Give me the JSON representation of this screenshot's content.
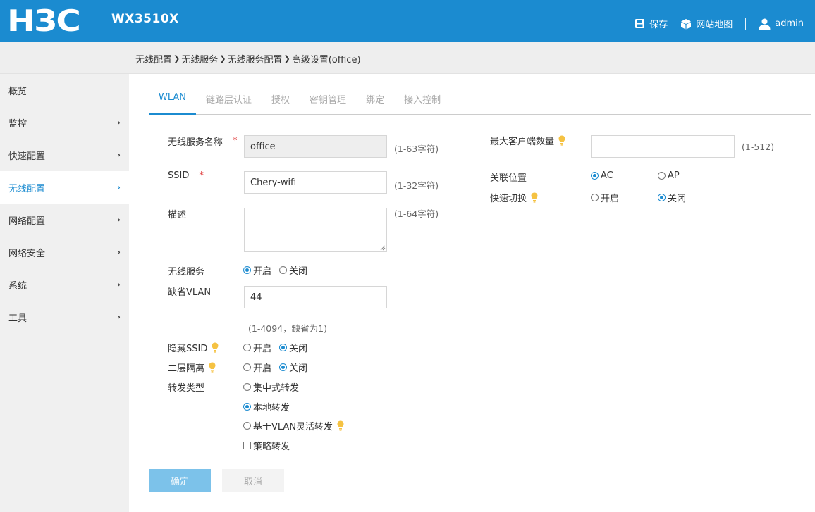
{
  "header": {
    "logo": "H3C",
    "model": "WX3510X",
    "save": "保存",
    "sitemap": "网站地图",
    "user": "admin"
  },
  "breadcrumb": [
    "无线配置",
    "无线服务",
    "无线服务配置",
    "高级设置(office)"
  ],
  "sidebar": {
    "items": [
      {
        "label": "概览",
        "arrow": ""
      },
      {
        "label": "监控",
        "arrow": "›"
      },
      {
        "label": "快速配置",
        "arrow": "›"
      },
      {
        "label": "无线配置",
        "arrow": "›"
      },
      {
        "label": "网络配置",
        "arrow": "›"
      },
      {
        "label": "网络安全",
        "arrow": "›"
      },
      {
        "label": "系统",
        "arrow": "›"
      },
      {
        "label": "工具",
        "arrow": "›"
      }
    ],
    "active_index": 3
  },
  "tabs": [
    "WLAN",
    "链路层认证",
    "授权",
    "密钥管理",
    "绑定",
    "接入控制"
  ],
  "form": {
    "service_name": {
      "label": "无线服务名称",
      "required": "*",
      "value": "office",
      "hint": "(1-63字符)"
    },
    "ssid": {
      "label": "SSID",
      "required": "*",
      "value": "Chery-wifi",
      "hint": "(1-32字符)"
    },
    "description": {
      "label": "描述",
      "value": "",
      "hint": "(1-64字符)"
    },
    "wireless_service": {
      "label": "无线服务",
      "on": "开启",
      "off": "关闭",
      "selected": "on"
    },
    "default_vlan": {
      "label": "缺省VLAN",
      "value": "44",
      "hint": "(1-4094，缺省为1)"
    },
    "hide_ssid": {
      "label": "隐藏SSID",
      "on": "开启",
      "off": "关闭",
      "selected": "off"
    },
    "l2_isolation": {
      "label": "二层隔离",
      "on": "开启",
      "off": "关闭",
      "selected": "off"
    },
    "forward_type": {
      "label": "转发类型",
      "options": [
        "集中式转发",
        "本地转发",
        "基于VLAN灵活转发"
      ],
      "selected": "本地转发",
      "policy_checkbox": "策略转发",
      "policy_checked": false
    },
    "max_clients": {
      "label": "最大客户端数量",
      "value": "",
      "hint": "(1-512)"
    },
    "assoc_location": {
      "label": "关联位置",
      "opt1": "AC",
      "opt2": "AP",
      "selected": "AC"
    },
    "fast_roaming": {
      "label": "快速切换",
      "on": "开启",
      "off": "关闭",
      "selected": "off"
    }
  },
  "buttons": {
    "ok": "确定",
    "cancel": "取消"
  },
  "colors": {
    "accent": "#1b8bd0",
    "required": "#e03c3c",
    "tip_bulb": "#f5c242"
  }
}
